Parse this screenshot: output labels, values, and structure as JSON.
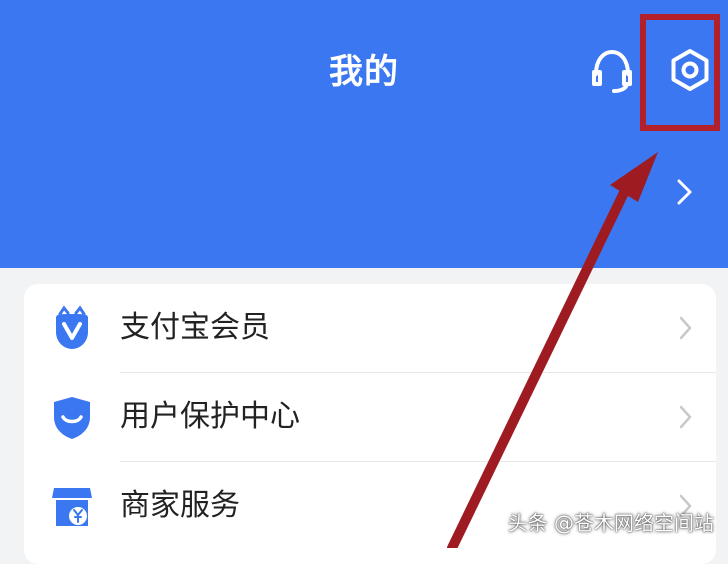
{
  "header": {
    "title": "我的",
    "icons": {
      "support": "headset-icon",
      "settings": "gear-icon",
      "row_chevron": "chevron-right-icon"
    }
  },
  "menu": {
    "items": [
      {
        "label": "支付宝会员",
        "icon": "member-badge-icon"
      },
      {
        "label": "用户保护中心",
        "icon": "shield-icon"
      },
      {
        "label": "商家服务",
        "icon": "store-icon"
      }
    ]
  },
  "annotations": {
    "highlight_color": "#b3202a",
    "arrow_color": "#9e1b22",
    "arrow_points_to": "gear-icon"
  },
  "watermark": "头条 @苍木网络空间站",
  "colors": {
    "header_bg": "#3b77f0",
    "icon_blue": "#3b77f0",
    "page_bg": "#f2f3f5"
  }
}
